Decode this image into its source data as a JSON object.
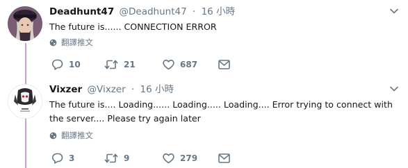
{
  "colors": {
    "thread_line": "#cc9fcf",
    "text_primary": "#14171a",
    "text_secondary": "#657786",
    "icon": "#657786"
  },
  "tweets": [
    {
      "display_name": "Deadhunt47",
      "handle": "@Deadhunt47",
      "separator": "·",
      "time": "16 小時",
      "text": "The future is...... CONNECTION ERROR",
      "translate_label": "翻譯推文",
      "replies": "10",
      "retweets": "21",
      "likes": "687",
      "icons": {
        "avatar": "avatar-anime-character",
        "reply": "reply-icon",
        "retweet": "retweet-icon",
        "like": "heart-icon",
        "dm": "envelope-icon",
        "translate": "globe-icon",
        "more": "chevron-down-icon"
      }
    },
    {
      "display_name": "Vixzer",
      "handle": "@Vixzer",
      "separator": "·",
      "time": "16 小時",
      "text": "The future is.... Loading...... Loading..... Loading.... Error trying to connect with the server.... Please try again later",
      "translate_label": "翻譯推文",
      "replies": "3",
      "retweets": "9",
      "likes": "279",
      "icons": {
        "avatar": "avatar-logo",
        "reply": "reply-icon",
        "retweet": "retweet-icon",
        "like": "heart-icon",
        "dm": "envelope-icon",
        "translate": "globe-icon",
        "more": "chevron-down-icon"
      }
    }
  ]
}
